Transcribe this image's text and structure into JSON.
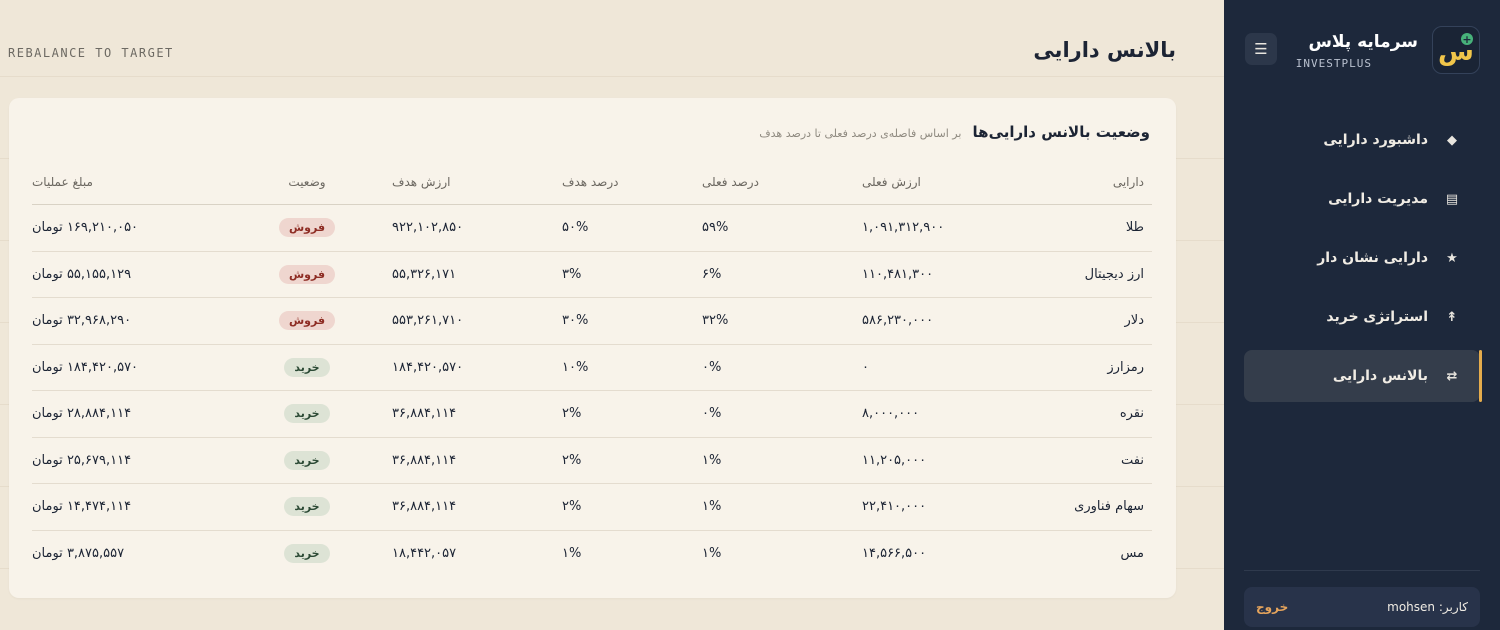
{
  "sidebar": {
    "brand_name": "سرمایه پلاس",
    "brand_sub": "INVESTPLUS",
    "logo_glyph": "س",
    "menu_icon": "☰",
    "items": [
      {
        "label": "داشبورد دارایی",
        "icon": "◆",
        "active": false
      },
      {
        "label": "مدیریت دارایی",
        "icon": "▤",
        "active": false
      },
      {
        "label": "دارایی نشان دار",
        "icon": "★",
        "active": false
      },
      {
        "label": "استراتژی خرید",
        "icon": "↟",
        "active": false
      },
      {
        "label": "بالانس دارایی",
        "icon": "⇄",
        "active": true
      }
    ],
    "user_label": "کاربر: mohsen",
    "logout_label": "خروج"
  },
  "header": {
    "title": "بالانس دارایی",
    "rebalance_label": "REBALANCE TO TARGET"
  },
  "card": {
    "title": "وضعیت بالانس دارایی‌ها",
    "subtitle": "بر اساس فاصله‌ی درصد فعلی تا درصد هدف"
  },
  "table": {
    "columns": [
      "دارایی",
      "ارزش فعلی",
      "درصد فعلی",
      "درصد هدف",
      "ارزش هدف",
      "وضعیت",
      "مبلغ عملیات"
    ],
    "rows": [
      {
        "asset": "طلا",
        "current_value": "۱,۰۹۱,۳۱۲,۹۰۰",
        "current_pct": "۵۹%",
        "target_pct": "۵۰%",
        "target_value": "۹۲۲,۱۰۲,۸۵۰",
        "status": "فروش",
        "status_type": "sell",
        "amount": "۱۶۹,۲۱۰,۰۵۰ تومان"
      },
      {
        "asset": "ارز دیجیتال",
        "current_value": "۱۱۰,۴۸۱,۳۰۰",
        "current_pct": "۶%",
        "target_pct": "۳%",
        "target_value": "۵۵,۳۲۶,۱۷۱",
        "status": "فروش",
        "status_type": "sell",
        "amount": "۵۵,۱۵۵,۱۲۹ تومان"
      },
      {
        "asset": "دلار",
        "current_value": "۵۸۶,۲۳۰,۰۰۰",
        "current_pct": "۳۲%",
        "target_pct": "۳۰%",
        "target_value": "۵۵۳,۲۶۱,۷۱۰",
        "status": "فروش",
        "status_type": "sell",
        "amount": "۳۲,۹۶۸,۲۹۰ تومان"
      },
      {
        "asset": "رمزارز",
        "current_value": "۰",
        "current_pct": "۰%",
        "target_pct": "۱۰%",
        "target_value": "۱۸۴,۴۲۰,۵۷۰",
        "status": "خرید",
        "status_type": "buy",
        "amount": "۱۸۴,۴۲۰,۵۷۰ تومان"
      },
      {
        "asset": "نقره",
        "current_value": "۸,۰۰۰,۰۰۰",
        "current_pct": "۰%",
        "target_pct": "۲%",
        "target_value": "۳۶,۸۸۴,۱۱۴",
        "status": "خرید",
        "status_type": "buy",
        "amount": "۲۸,۸۸۴,۱۱۴ تومان"
      },
      {
        "asset": "نفت",
        "current_value": "۱۱,۲۰۵,۰۰۰",
        "current_pct": "۱%",
        "target_pct": "۲%",
        "target_value": "۳۶,۸۸۴,۱۱۴",
        "status": "خرید",
        "status_type": "buy",
        "amount": "۲۵,۶۷۹,۱۱۴ تومان"
      },
      {
        "asset": "سهام فناوری",
        "current_value": "۲۲,۴۱۰,۰۰۰",
        "current_pct": "۱%",
        "target_pct": "۲%",
        "target_value": "۳۶,۸۸۴,۱۱۴",
        "status": "خرید",
        "status_type": "buy",
        "amount": "۱۴,۴۷۴,۱۱۴ تومان"
      },
      {
        "asset": "مس",
        "current_value": "۱۴,۵۶۶,۵۰۰",
        "current_pct": "۱%",
        "target_pct": "۱%",
        "target_value": "۱۸,۴۴۲,۰۵۷",
        "status": "خرید",
        "status_type": "buy",
        "amount": "۳,۸۷۵,۵۵۷ تومان"
      }
    ]
  },
  "colors": {
    "sidebar_bg": "#1d283b",
    "page_bg": "#efe7d8",
    "card_bg": "#f8f3ea",
    "accent": "#e5ac4c",
    "sell_badge_bg": "#efd6cf",
    "buy_badge_bg": "#dde3d5"
  }
}
